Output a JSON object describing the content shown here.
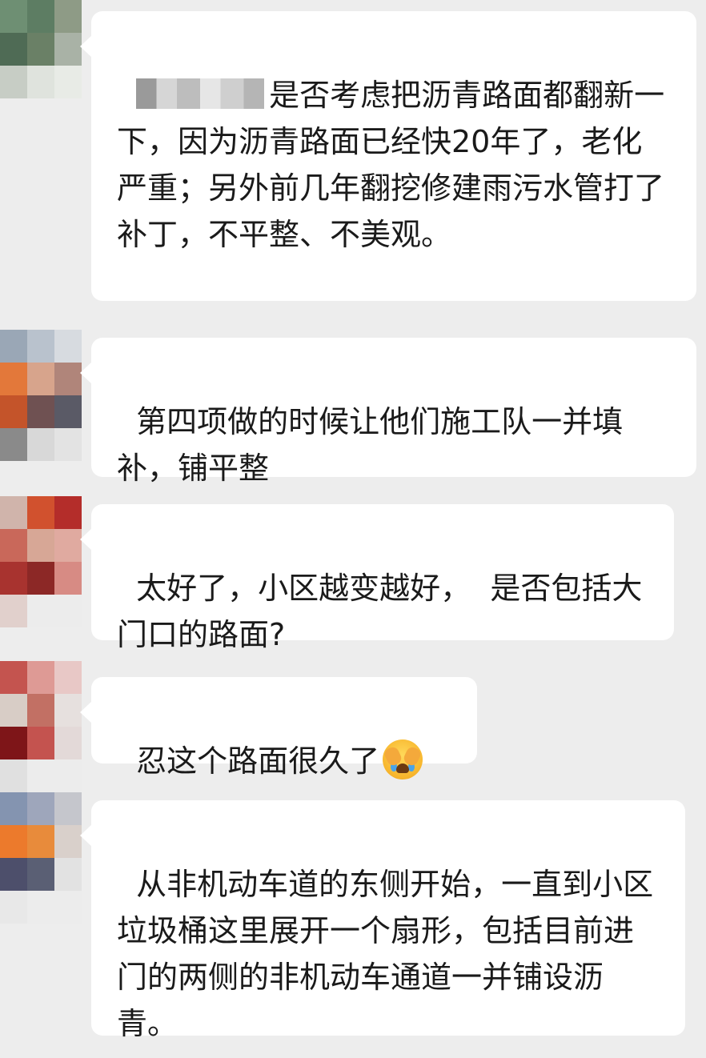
{
  "chat": {
    "messages": [
      {
        "sender": "redacted",
        "text": "是否考虑把沥青路面都翻新一下，因为沥青路面已经快20年了，老化严重；另外前几年翻挖修建雨污水管打了补丁，不平整、不美观。",
        "avatar_colors": [
          "#9aa89a",
          "#7f9a83",
          "#b8c1b7",
          "#6e8f73",
          "#5d7d63",
          "#8e9b86",
          "#4f6b55",
          "#6a8066",
          "#a9b2a6",
          "#c7cdc5",
          "#dfe3dd",
          "#e8ebe6"
        ]
      },
      {
        "sender": "blurred",
        "text": "第四项做的时候让他们施工队一并填补，铺平整",
        "avatar_colors": [
          "#9aa7b6",
          "#b9c2cd",
          "#d7dbe0",
          "#e3783a",
          "#d7a48c",
          "#b0857a",
          "#c4542a",
          "#6f5152",
          "#5a5a66",
          "#8a8a8a",
          "#d8d8d8",
          "#e3e3e3"
        ]
      },
      {
        "sender": "blurred",
        "text": "太好了，小区越变越好，  是否包括大门口的路面?",
        "avatar_colors": [
          "#d0b4ab",
          "#d1512e",
          "#b42d2a",
          "#c9685a",
          "#d7a796",
          "#e0aaa0",
          "#a8332f",
          "#8c2826",
          "#d78b84",
          "#e1d0cc",
          "#ececec",
          "#ececec"
        ]
      },
      {
        "sender": "blurred",
        "text": "忍这个路面很久了",
        "emoji": "face-with-hands-crying-emoji",
        "avatar_colors": [
          "#c4544f",
          "#de9a95",
          "#e8c8c6",
          "#d8cdc6",
          "#c27064",
          "#e6e0de",
          "#7e1518",
          "#c4534f",
          "#e3d9d8",
          "#e0e0e0",
          "#ececec",
          "#ececec"
        ]
      },
      {
        "sender": "blurred",
        "text": "从非机动车道的东侧开始，一直到小区垃圾桶这里展开一个扇形，包括目前进门的两侧的非机动车通道一并铺设沥青。",
        "avatar_colors": [
          "#8494b0",
          "#9ea6bb",
          "#c5c6cc",
          "#ec7a2c",
          "#e88b3b",
          "#d9d0cb",
          "#4d4f6b",
          "#5a5f74",
          "#e2e2e2",
          "#e8e8e8",
          "#ececec",
          "#ececec"
        ]
      }
    ]
  }
}
